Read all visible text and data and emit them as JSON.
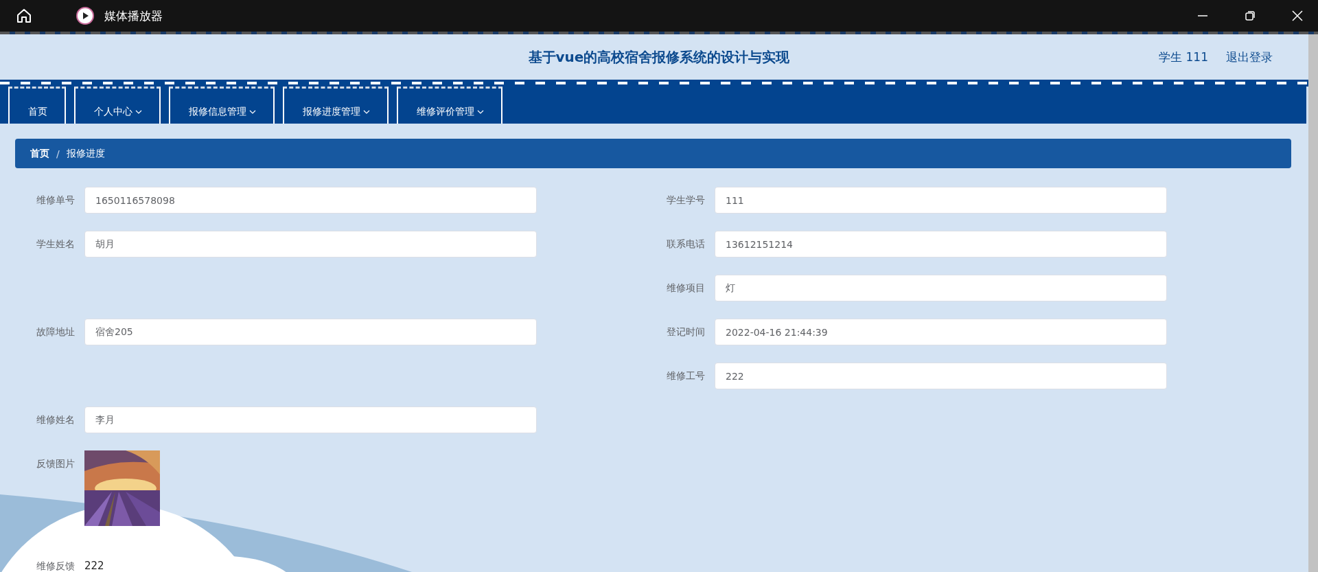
{
  "window": {
    "title": "媒体播放器"
  },
  "header": {
    "title": "基于vue的高校宿舍报修系统的设计与实现",
    "user": "学生 111",
    "logout": "退出登录"
  },
  "nav": [
    {
      "label": "首页",
      "dropdown": false
    },
    {
      "label": "个人中心",
      "dropdown": true
    },
    {
      "label": "报修信息管理",
      "dropdown": true
    },
    {
      "label": "报修进度管理",
      "dropdown": true
    },
    {
      "label": "维修评价管理",
      "dropdown": true
    }
  ],
  "breadcrumb": [
    "首页",
    "报修进度"
  ],
  "breadcrumb_separator": "/",
  "rows": [
    {
      "left": {
        "label": "维修单号",
        "kind": "input",
        "value": "1650116578098"
      },
      "right": {
        "label": "学生学号",
        "kind": "input",
        "value": "111"
      }
    },
    {
      "left": {
        "label": "学生姓名",
        "kind": "input",
        "value": "胡月"
      },
      "right": {
        "label": "联系电话",
        "kind": "input",
        "value": "13612151214"
      }
    },
    {
      "right": {
        "label": "维修项目",
        "kind": "input",
        "value": "灯"
      }
    },
    {
      "left": {
        "label": "故障地址",
        "kind": "input",
        "value": "宿舍205"
      },
      "right": {
        "label": "登记时间",
        "kind": "input",
        "value": "2022-04-16 21:44:39"
      }
    },
    {
      "right": {
        "label": "维修工号",
        "kind": "input",
        "value": "222"
      }
    },
    {
      "left": {
        "label": "维修姓名",
        "kind": "input",
        "value": "李月"
      }
    },
    {
      "left": {
        "label": "反馈图片",
        "kind": "picture"
      }
    },
    {
      "left": {
        "label": "维修反馈",
        "kind": "text",
        "value": "222"
      }
    }
  ]
}
